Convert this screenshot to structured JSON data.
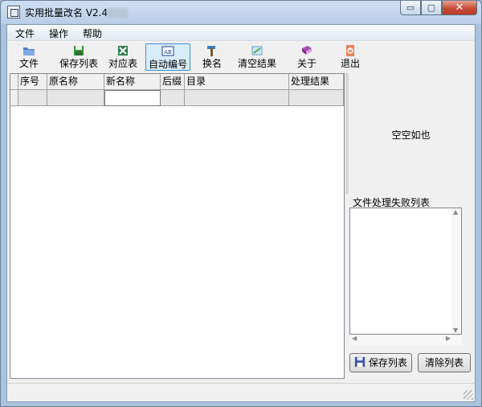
{
  "window": {
    "title": "实用批量改名 V2.4"
  },
  "caption": {
    "minimize": "▭",
    "maximize": "▢",
    "close": "✕"
  },
  "menu": [
    "文件",
    "操作",
    "帮助"
  ],
  "toolbar": [
    {
      "label": "文件",
      "icon": "folder-icon"
    },
    {
      "label": "保存列表",
      "icon": "save-icon"
    },
    {
      "label": "对应表",
      "icon": "excel-icon"
    },
    {
      "label": "自动编号",
      "icon": "auto-number-icon"
    },
    {
      "label": "换名",
      "icon": "rename-hammer-icon"
    },
    {
      "label": "清空结果",
      "icon": "clear-icon"
    },
    {
      "label": "关于",
      "icon": "book-icon"
    },
    {
      "label": "退出",
      "icon": "exit-icon"
    }
  ],
  "table": {
    "columns": [
      "序号",
      "原名称",
      "新名称",
      "后缀",
      "目录",
      "处理结果"
    ]
  },
  "right_panel": {
    "empty_text": "空空如也",
    "fail_title": "文件处理失败列表",
    "save_button": "保存列表",
    "clear_button": "清除列表"
  },
  "colors": {
    "active_button_border": "#3d8fd8",
    "close_button": "#c94c36"
  }
}
